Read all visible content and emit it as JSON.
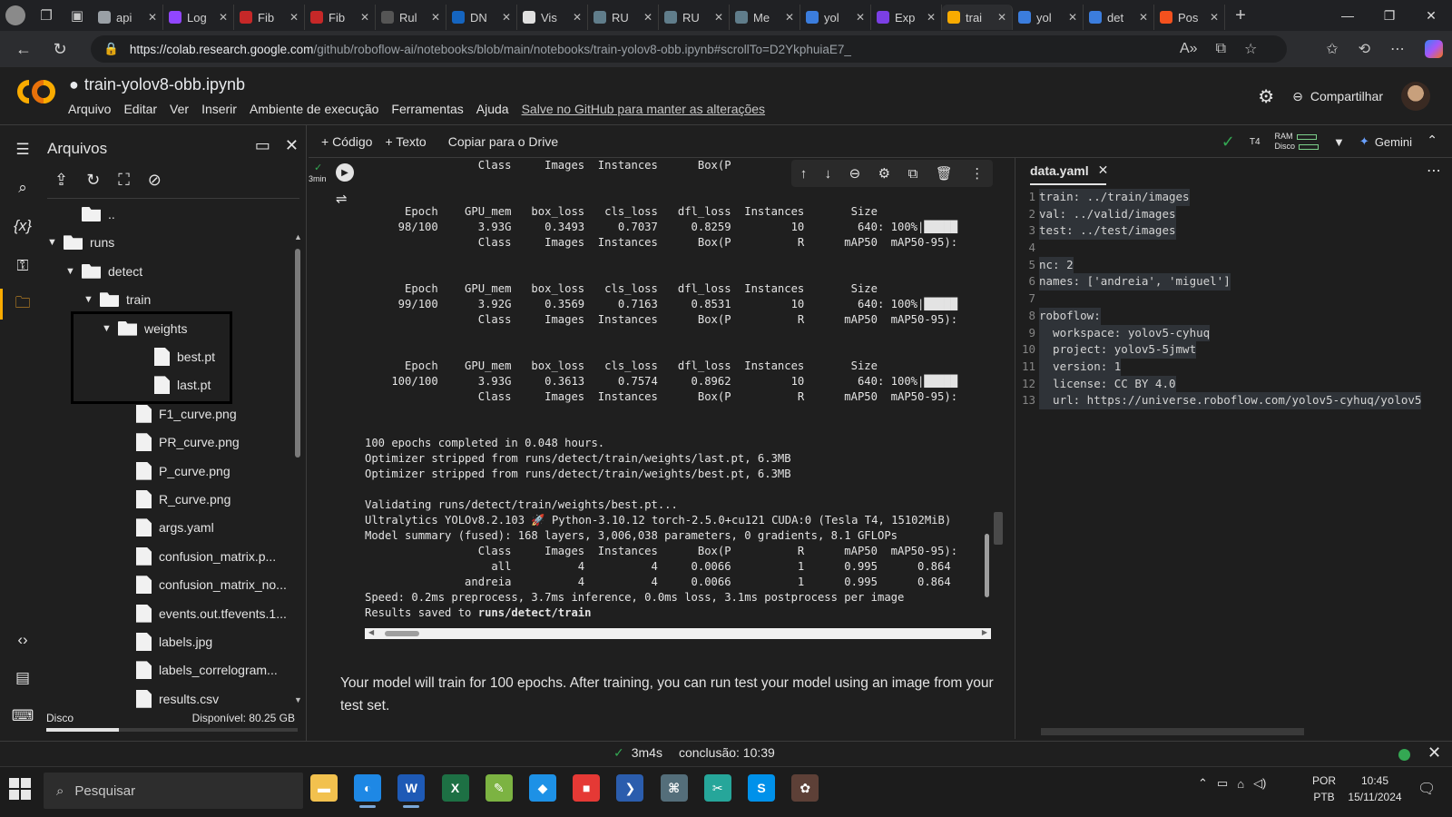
{
  "browser": {
    "tabs": [
      {
        "label": "api",
        "color": "#9aa0a6"
      },
      {
        "label": "Log",
        "color": "#9146ff"
      },
      {
        "label": "Fib",
        "color": "#c62828"
      },
      {
        "label": "Fib",
        "color": "#c62828"
      },
      {
        "label": "Rul",
        "color": "#555555"
      },
      {
        "label": "DN",
        "color": "#1565c0"
      },
      {
        "label": "Vis",
        "color": "#e0e0e0"
      },
      {
        "label": "RU",
        "color": "#607d8b"
      },
      {
        "label": "RU",
        "color": "#607d8b"
      },
      {
        "label": "Me",
        "color": "#607d8b"
      },
      {
        "label": "yol",
        "color": "#3b7ddd"
      },
      {
        "label": "Exp",
        "color": "#7b3fe4"
      },
      {
        "label": "trai",
        "color": "#f9ab00",
        "active": true
      },
      {
        "label": "yol",
        "color": "#3b7ddd"
      },
      {
        "label": "det",
        "color": "#3b7ddd"
      },
      {
        "label": "Pos",
        "color": "#f4511e"
      }
    ],
    "url_host": "https://colab.research.google.com",
    "url_path": "/github/roboflow-ai/notebooks/blob/main/notebooks/train-yolov8-obb.ipynb#scrollTo=D2YkphuiaE7_"
  },
  "header": {
    "notebook_title": "train-yolov8-obb.ipynb",
    "menu": [
      "Arquivo",
      "Editar",
      "Ver",
      "Inserir",
      "Ambiente de execução",
      "Ferramentas",
      "Ajuda"
    ],
    "save_link": "Salve no GitHub para manter as alterações",
    "share_label": "Compartilhar"
  },
  "files_panel": {
    "title": "Arquivos",
    "tree": [
      {
        "label": "..",
        "kind": "folder",
        "depth": 1,
        "arrow": ""
      },
      {
        "label": "runs",
        "kind": "folder",
        "depth": 0,
        "arrow": "▼"
      },
      {
        "label": "detect",
        "kind": "folder",
        "depth": 1,
        "arrow": "▼"
      },
      {
        "label": "train",
        "kind": "folder",
        "depth": 2,
        "arrow": "▼"
      },
      {
        "label": "weights",
        "kind": "folder",
        "depth": 3,
        "arrow": "▼"
      },
      {
        "label": "best.pt",
        "kind": "file",
        "depth": 5,
        "arrow": ""
      },
      {
        "label": "last.pt",
        "kind": "file",
        "depth": 5,
        "arrow": ""
      },
      {
        "label": "F1_curve.png",
        "kind": "file",
        "depth": 4,
        "arrow": ""
      },
      {
        "label": "PR_curve.png",
        "kind": "file",
        "depth": 4,
        "arrow": ""
      },
      {
        "label": "P_curve.png",
        "kind": "file",
        "depth": 4,
        "arrow": ""
      },
      {
        "label": "R_curve.png",
        "kind": "file",
        "depth": 4,
        "arrow": ""
      },
      {
        "label": "args.yaml",
        "kind": "file",
        "depth": 4,
        "arrow": ""
      },
      {
        "label": "confusion_matrix.p...",
        "kind": "file",
        "depth": 4,
        "arrow": ""
      },
      {
        "label": "confusion_matrix_no...",
        "kind": "file",
        "depth": 4,
        "arrow": ""
      },
      {
        "label": "events.out.tfevents.1...",
        "kind": "file",
        "depth": 4,
        "arrow": ""
      },
      {
        "label": "labels.jpg",
        "kind": "file",
        "depth": 4,
        "arrow": ""
      },
      {
        "label": "labels_correlogram...",
        "kind": "file",
        "depth": 4,
        "arrow": ""
      },
      {
        "label": "results.csv",
        "kind": "file",
        "depth": 4,
        "arrow": ""
      }
    ],
    "disk_label": "Disco",
    "disk_available": "Disponível: 80.25 GB",
    "disk_used_fraction": 0.29
  },
  "toolbar": {
    "add_code": "+ Código",
    "add_text": "+ Texto",
    "copy_drive": "Copiar para o Drive",
    "runtime": "T4",
    "ram_label": "RAM",
    "disk_label": "Disco",
    "gemini": "Gemini"
  },
  "cell": {
    "exec_time": "3min",
    "output_lines": [
      "                 Class     Images  Instances      Box(P          R      mAP50  mAP50-95): ",
      "",
      "",
      "      Epoch    GPU_mem   box_loss   cls_loss   dfl_loss  Instances       Size",
      "     98/100      3.93G     0.3493     0.7037     0.8259         10        640: 100%|█████",
      "                 Class     Images  Instances      Box(P          R      mAP50  mAP50-95): ",
      "",
      "",
      "      Epoch    GPU_mem   box_loss   cls_loss   dfl_loss  Instances       Size",
      "     99/100      3.92G     0.3569     0.7163     0.8531         10        640: 100%|█████",
      "                 Class     Images  Instances      Box(P          R      mAP50  mAP50-95): ",
      "",
      "",
      "      Epoch    GPU_mem   box_loss   cls_loss   dfl_loss  Instances       Size",
      "    100/100      3.93G     0.3613     0.7574     0.8962         10        640: 100%|█████",
      "                 Class     Images  Instances      Box(P          R      mAP50  mAP50-95): ",
      "",
      "",
      "100 epochs completed in 0.048 hours.",
      "Optimizer stripped from runs/detect/train/weights/last.pt, 6.3MB",
      "Optimizer stripped from runs/detect/train/weights/best.pt, 6.3MB",
      "",
      "Validating runs/detect/train/weights/best.pt...",
      "Ultralytics YOLOv8.2.103 🚀 Python-3.10.12 torch-2.5.0+cu121 CUDA:0 (Tesla T4, 15102MiB)",
      "Model summary (fused): 168 layers, 3,006,038 parameters, 0 gradients, 8.1 GFLOPs",
      "                 Class     Images  Instances      Box(P          R      mAP50  mAP50-95): ",
      "                   all          4          4     0.0066          1      0.995      0.864",
      "               andreia          4          4     0.0066          1      0.995      0.864",
      "Speed: 0.2ms preprocess, 3.7ms inference, 0.0ms loss, 3.1ms postprocess per image"
    ],
    "results_prefix": "Results saved to ",
    "results_path": "runs/detect/train"
  },
  "markdown": {
    "text": "Your model will train for 100 epochs. After training, you can run test your model using an image from your test set."
  },
  "editor": {
    "filename": "data.yaml",
    "lines": [
      "train: ../train/images",
      "val: ../valid/images",
      "test: ../test/images",
      "",
      "nc: 2",
      "names: ['andreia', 'miguel']",
      "",
      "roboflow:",
      "  workspace: yolov5-cyhuq",
      "  project: yolov5-5jmwt",
      "  version: 1",
      "  license: CC BY 4.0",
      "  url: https://universe.roboflow.com/yolov5-cyhuq/yolov5"
    ]
  },
  "statusbar": {
    "elapsed": "3m4s",
    "completion": "conclusão: 10:39"
  },
  "taskbar": {
    "search_placeholder": "Pesquisar",
    "lang_top": "POR",
    "lang_bottom": "PTB",
    "time": "10:45",
    "date": "15/11/2024",
    "apps": [
      {
        "name": "file-explorer",
        "glyph": "▬",
        "color": "#f2c14e"
      },
      {
        "name": "edge",
        "glyph": "◐",
        "color": "#1e88e5",
        "running": true
      },
      {
        "name": "word",
        "glyph": "W",
        "color": "#1e5ab6",
        "running": true
      },
      {
        "name": "excel",
        "glyph": "X",
        "color": "#1d7044"
      },
      {
        "name": "notepad-plus",
        "glyph": "✎",
        "color": "#7cb342"
      },
      {
        "name": "docker",
        "glyph": "◆",
        "color": "#1d91e6"
      },
      {
        "name": "paint",
        "glyph": "■",
        "color": "#e53935"
      },
      {
        "name": "powershell",
        "glyph": "❯",
        "color": "#2b5dad"
      },
      {
        "name": "network-app",
        "glyph": "⌘",
        "color": "#546e7a"
      },
      {
        "name": "snipping-tool",
        "glyph": "✂",
        "color": "#26a69a"
      },
      {
        "name": "skype",
        "glyph": "S",
        "color": "#0091ea"
      },
      {
        "name": "paint-palette",
        "glyph": "✿",
        "color": "#5d4037"
      }
    ]
  }
}
